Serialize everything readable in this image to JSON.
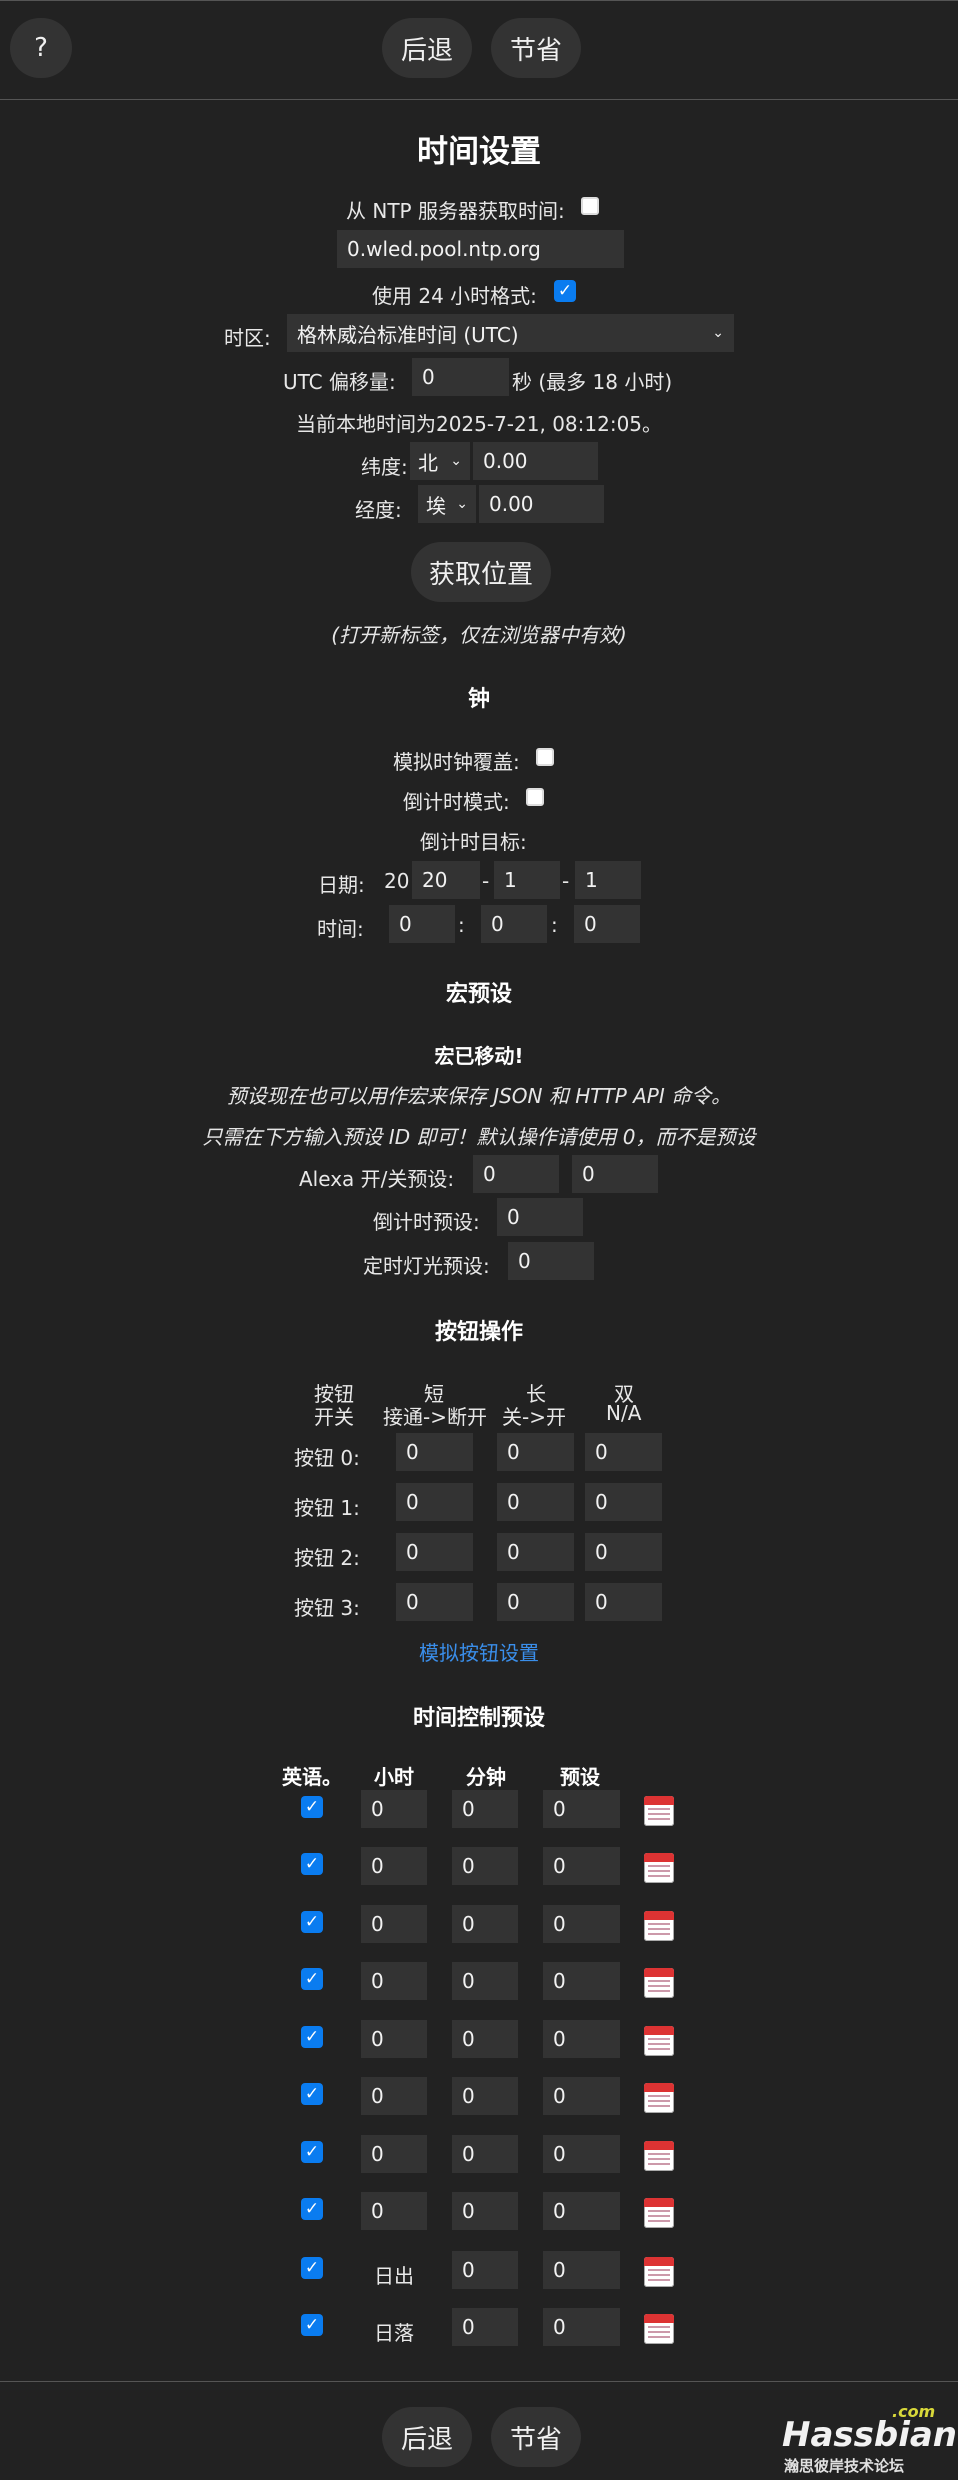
{
  "nav": {
    "help": "?",
    "back": "后退",
    "save": "节省"
  },
  "time": {
    "title": "时间设置",
    "ntp_label": "从 NTP 服务器获取时间:",
    "ntp_server": "0.wled.pool.ntp.org",
    "h24_label": "使用 24 小时格式:",
    "tz_label": "时区:",
    "tz_value": "格林威治标准时间 (UTC)",
    "utc_label": "UTC 偏移量:",
    "utc_value": "0",
    "utc_suffix": "秒 (最多 18 小时)",
    "local_time": "当前本地时间为2025-7-21, 08:12:05。",
    "lat_label": "纬度:",
    "lat_dir": "北",
    "lat_value": "0.00",
    "lon_label": "经度:",
    "lon_dir": "埃",
    "lon_value": "0.00",
    "get_location": "获取位置",
    "note": "(打开新标签，仅在浏览器中有效)"
  },
  "clock": {
    "title": "钟",
    "analog_label": "模拟时钟覆盖:",
    "countdown_label": "倒计时模式:",
    "target_label": "倒计时目标:",
    "date_label": "日期:",
    "year_prefix": "20",
    "year": "20",
    "month": "1",
    "day": "1",
    "time_label": "时间:",
    "hour": "0",
    "minute": "0",
    "second": "0"
  },
  "macro": {
    "title": "宏预设",
    "moved": "宏已移动!",
    "line1": "预设现在也可以用作宏来保存 JSON 和 HTTP API 命令。",
    "line2": "只需在下方输入预设 ID 即可！默认操作请使用 0，而不是预设",
    "alexa_label": "Alexa 开/关预设:",
    "alexa_on": "0",
    "alexa_off": "0",
    "countdown_label": "倒计时预设:",
    "countdown_value": "0",
    "timer_label": "定时灯光预设:",
    "timer_value": "0"
  },
  "buttons": {
    "title": "按钮操作",
    "col1a": "按钮",
    "col1b": "开关",
    "col2a": "短",
    "col2b": "接通->断开",
    "col3a": "长",
    "col3b": "关->开",
    "col4a": "双",
    "col4b": "N/A",
    "rows": [
      {
        "label": "按钮 0:",
        "v": [
          "0",
          "0",
          "0"
        ]
      },
      {
        "label": "按钮 1:",
        "v": [
          "0",
          "0",
          "0"
        ]
      },
      {
        "label": "按钮 2:",
        "v": [
          "0",
          "0",
          "0"
        ]
      },
      {
        "label": "按钮 3:",
        "v": [
          "0",
          "0",
          "0"
        ]
      }
    ],
    "analog_link": "模拟按钮设置"
  },
  "timers": {
    "title": "时间控制预设",
    "h_en": "英语。",
    "h_hour": "小时",
    "h_min": "分钟",
    "h_preset": "预设",
    "rows": [
      {
        "hour": "0",
        "min": "0",
        "preset": "0"
      },
      {
        "hour": "0",
        "min": "0",
        "preset": "0"
      },
      {
        "hour": "0",
        "min": "0",
        "preset": "0"
      },
      {
        "hour": "0",
        "min": "0",
        "preset": "0"
      },
      {
        "hour": "0",
        "min": "0",
        "preset": "0"
      },
      {
        "hour": "0",
        "min": "0",
        "preset": "0"
      },
      {
        "hour": "0",
        "min": "0",
        "preset": "0"
      },
      {
        "hour": "0",
        "min": "0",
        "preset": "0"
      },
      {
        "hour_text": "日出",
        "min": "0",
        "preset": "0"
      },
      {
        "hour_text": "日落",
        "min": "0",
        "preset": "0"
      }
    ]
  },
  "watermark": {
    "brand": "Hassbian",
    "com": ".com",
    "sub": "瀚思彼岸技术论坛"
  },
  "colors": {
    "bg": "#222222",
    "field": "#333333",
    "accent": "#0a7cf0",
    "link": "#3a8eea"
  }
}
